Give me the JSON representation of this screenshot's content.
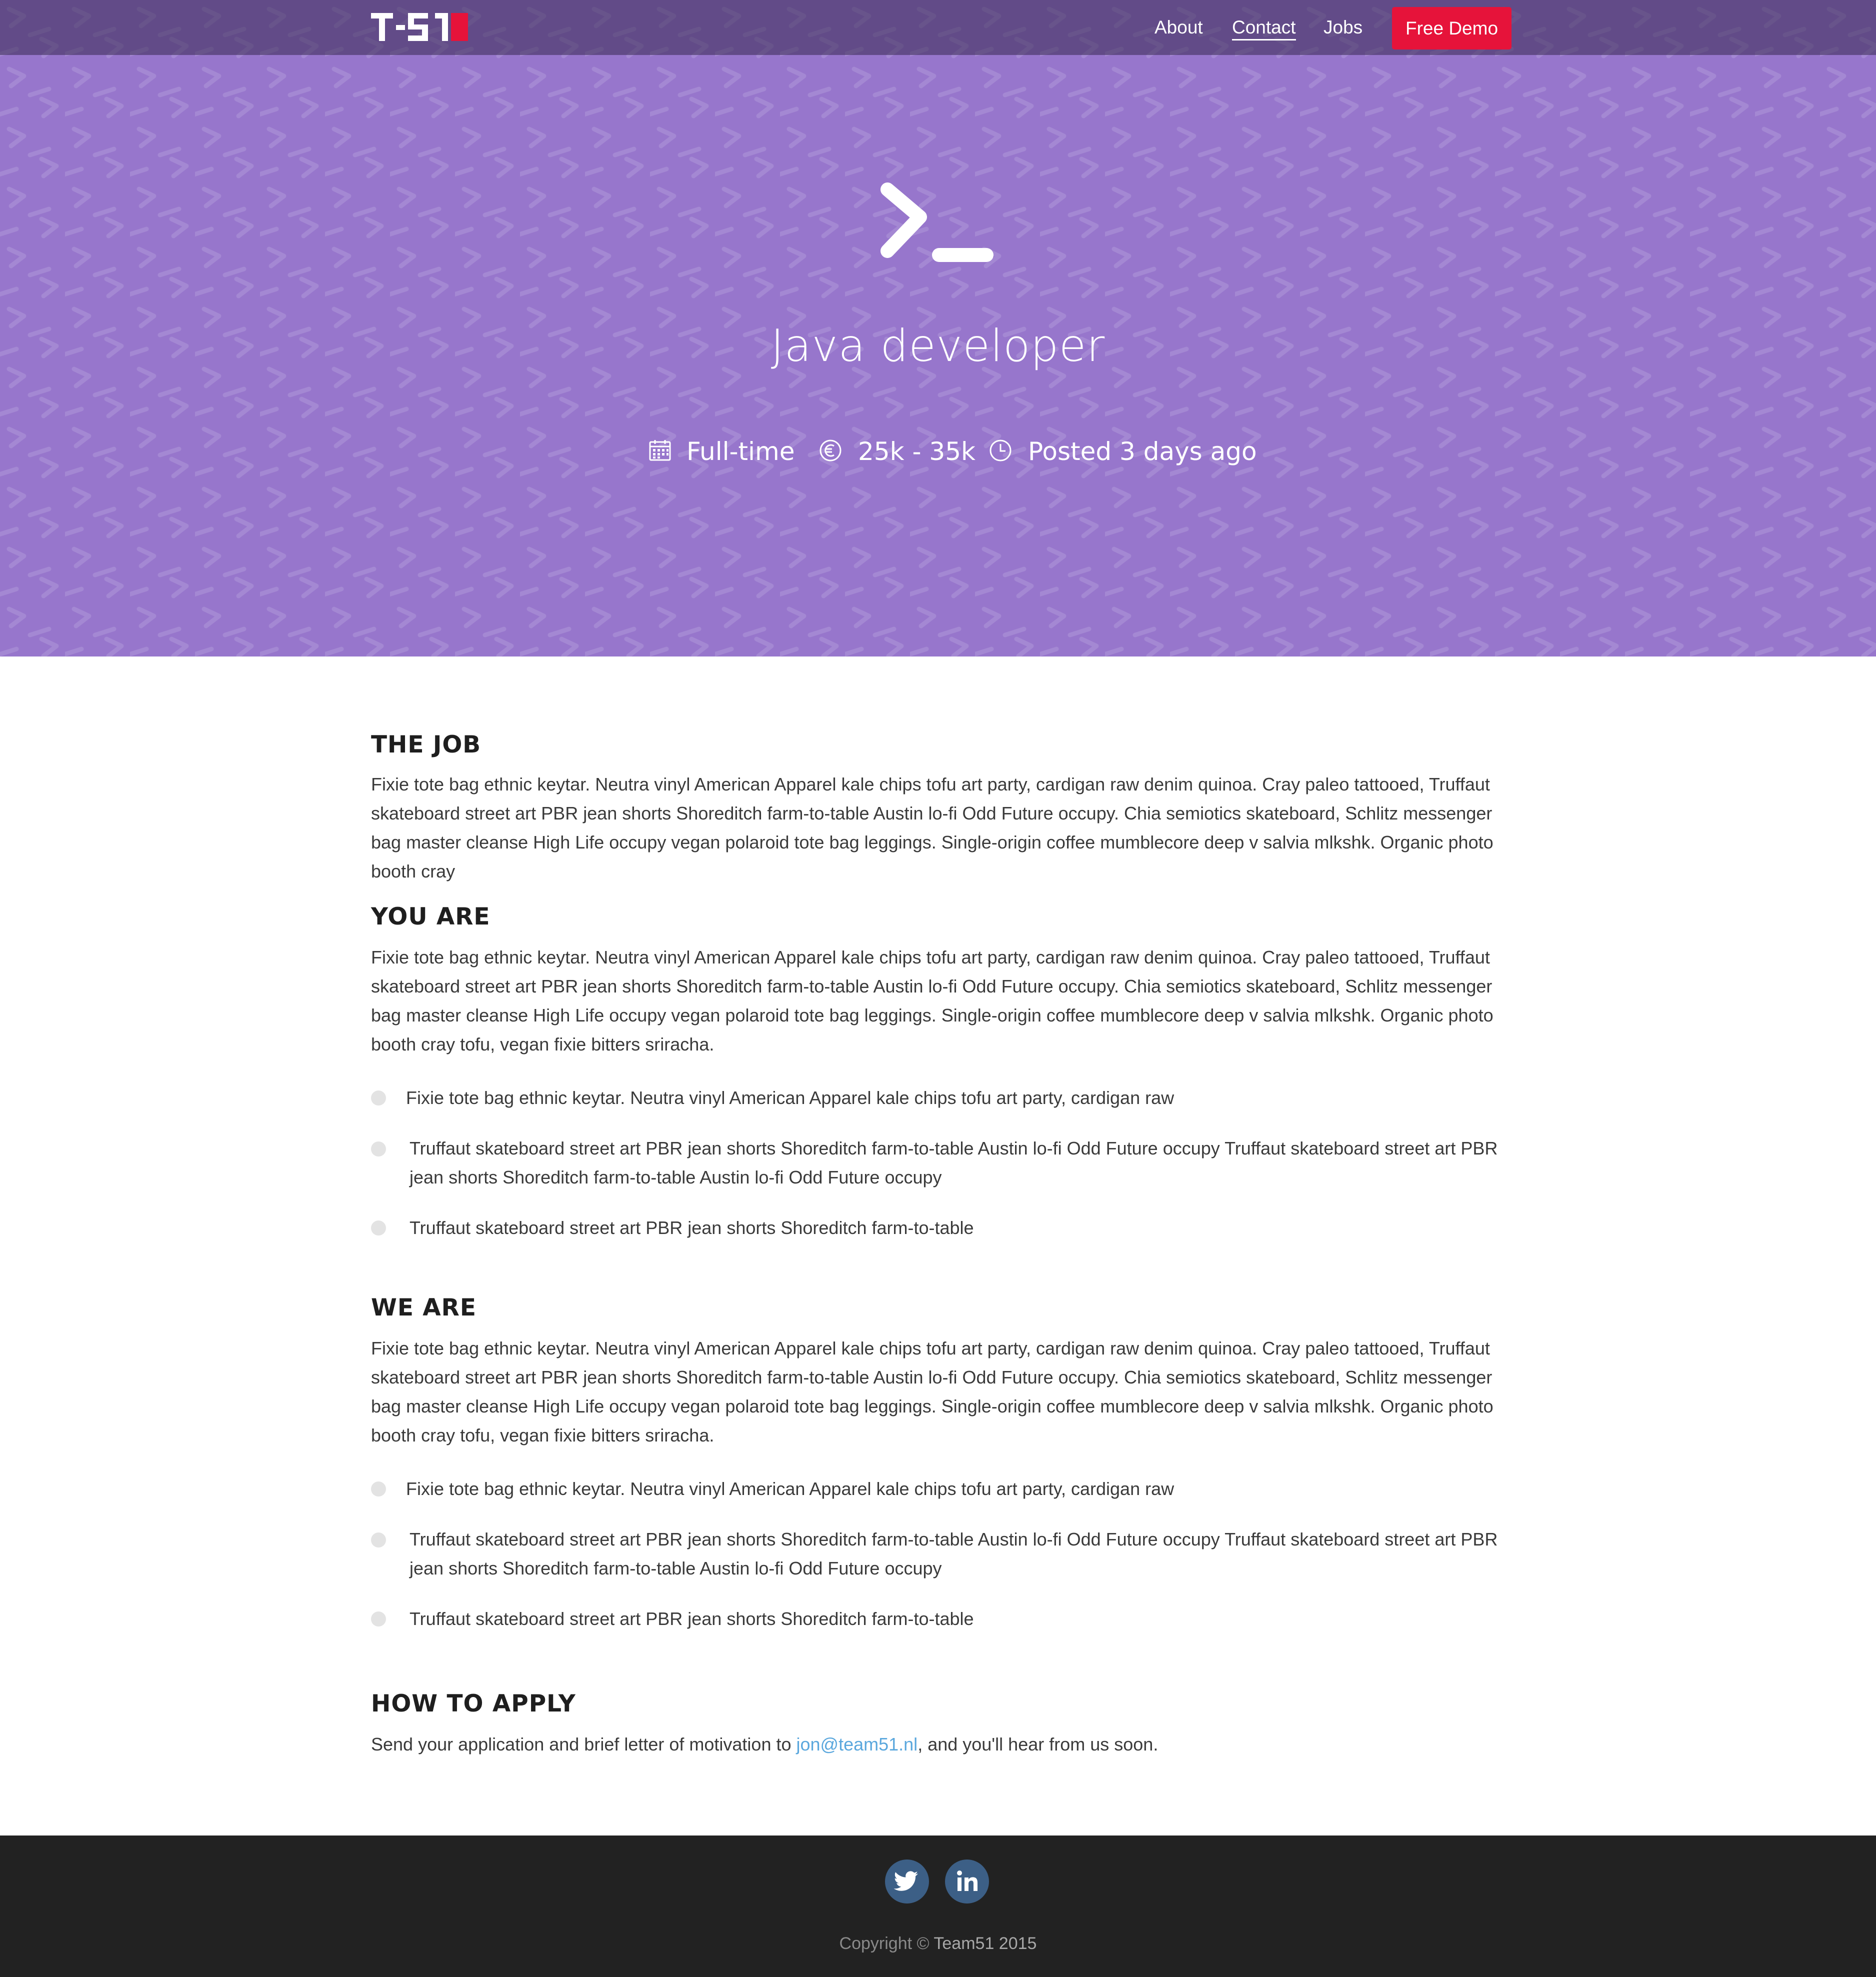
{
  "colors": {
    "hero_bg": "#9776cc",
    "navbar_bg": "#4e3d63",
    "cta_bg": "#e6133a",
    "footer_bg": "#222222",
    "social_bg": "#3c5f86",
    "link": "#5aa7dd"
  },
  "nav": {
    "logo_text": "T-51",
    "links": [
      {
        "label": "About"
      },
      {
        "label": "Contact"
      },
      {
        "label": "Jobs"
      }
    ],
    "cta_label": "Free Demo"
  },
  "hero": {
    "icon": "terminal-prompt-icon",
    "title": "Java developer",
    "meta": [
      {
        "icon": "calendar-icon",
        "text": "Full-time"
      },
      {
        "icon": "euro-icon",
        "text": "25k - 35k"
      },
      {
        "icon": "clock-icon",
        "text": "Posted 3 days ago"
      }
    ]
  },
  "sections": {
    "job": {
      "title": "THE JOB",
      "body": "Fixie tote bag ethnic keytar. Neutra vinyl American Apparel kale chips tofu art party, cardigan raw denim quinoa. Cray paleo tattooed, Truffaut skateboard street art PBR jean shorts Shoreditch farm-to-table Austin lo-fi Odd Future occupy. Chia semiotics skateboard, Schlitz messenger bag master cleanse High Life occupy vegan polaroid tote bag leggings. Single-origin coffee mumblecore deep v salvia mlkshk. Organic photo booth cray"
    },
    "you_are": {
      "title": "YOU ARE",
      "body": "Fixie tote bag ethnic keytar. Neutra vinyl American Apparel kale chips tofu art party, cardigan raw denim quinoa. Cray paleo tattooed, Truffaut skateboard street art PBR jean shorts Shoreditch farm-to-table Austin lo-fi Odd Future occupy. Chia semiotics skateboard, Schlitz messenger bag master cleanse High Life occupy vegan polaroid tote bag leggings. Single-origin coffee mumblecore deep v salvia mlkshk. Organic photo booth cray tofu, vegan fixie bitters sriracha.",
      "items": [
        "Fixie tote bag ethnic keytar. Neutra vinyl American Apparel kale chips tofu art party, cardigan raw",
        "Truffaut skateboard street art PBR jean shorts Shoreditch farm-to-table Austin lo-fi Odd Future occupy  Truffaut skateboard street art PBR jean shorts Shoreditch farm-to-table Austin lo-fi Odd Future occupy",
        "Truffaut skateboard street art PBR jean shorts Shoreditch farm-to-table"
      ]
    },
    "we_are": {
      "title": "WE ARE",
      "body": "Fixie tote bag ethnic keytar. Neutra vinyl American Apparel kale chips tofu art party, cardigan raw denim quinoa. Cray paleo tattooed, Truffaut skateboard street art PBR jean shorts Shoreditch farm-to-table Austin lo-fi Odd Future occupy. Chia semiotics skateboard, Schlitz messenger bag master cleanse High Life occupy vegan polaroid tote bag leggings. Single-origin coffee mumblecore deep v salvia mlkshk. Organic photo booth cray tofu, vegan fixie bitters sriracha.",
      "items": [
        "Fixie tote bag ethnic keytar. Neutra vinyl American Apparel kale chips tofu art party, cardigan raw",
        "Truffaut skateboard street art PBR jean shorts Shoreditch farm-to-table Austin lo-fi Odd Future occupy  Truffaut skateboard street art PBR jean shorts Shoreditch farm-to-table Austin lo-fi Odd Future occupy",
        "Truffaut skateboard street art PBR jean shorts Shoreditch farm-to-table"
      ]
    },
    "apply": {
      "title": "HOW TO APPLY",
      "text_before": "Send your application and brief letter of motivation to ",
      "email": "jon@team51.nl",
      "text_after": ", and you'll hear from us soon."
    }
  },
  "footer": {
    "social": [
      {
        "icon": "twitter-icon"
      },
      {
        "icon": "linkedin-icon"
      }
    ],
    "copyright_prefix": "Copyright © ",
    "copyright_brand": "Team51 2015"
  }
}
